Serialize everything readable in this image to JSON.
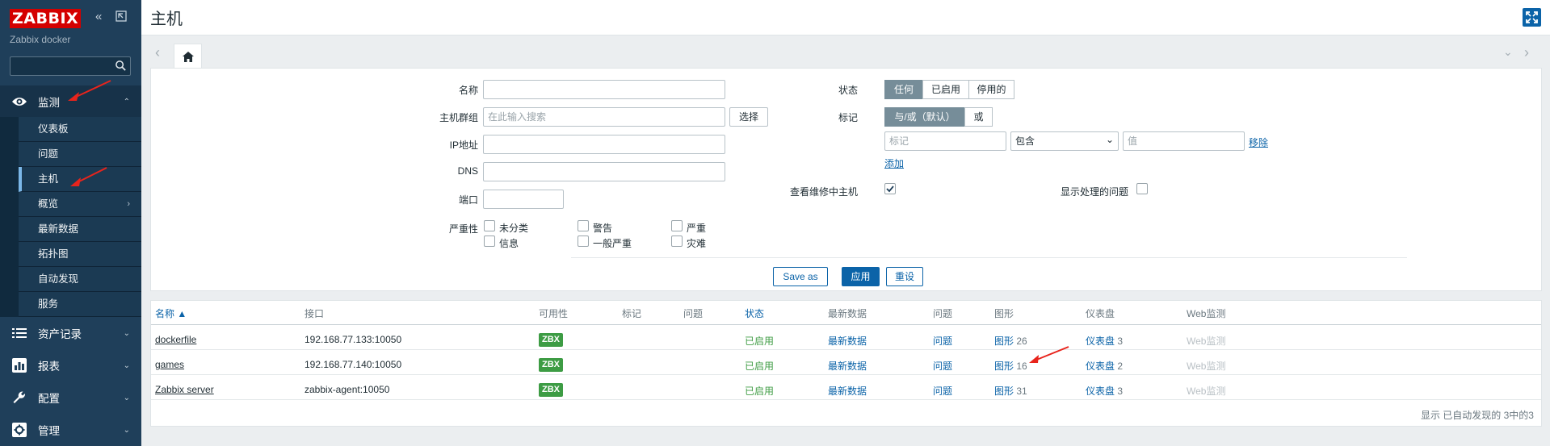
{
  "sidebar": {
    "logo": "ZABBIX",
    "instance": "Zabbix docker",
    "search_value": "",
    "menu": [
      {
        "label": "监测",
        "icon": "eye-icon"
      },
      {
        "label": "资产记录",
        "icon": "list-icon"
      },
      {
        "label": "报表",
        "icon": "bar-chart-icon"
      },
      {
        "label": "配置",
        "icon": "wrench-icon"
      },
      {
        "label": "管理",
        "icon": "gear-icon"
      }
    ],
    "submenu": [
      "仪表板",
      "问题",
      "主机",
      "概览",
      "最新数据",
      "拓扑图",
      "自动发现",
      "服务"
    ]
  },
  "header": {
    "title": "主机"
  },
  "filter": {
    "name_label": "名称",
    "hostgroup_label": "主机群组",
    "hostgroup_placeholder": "在此输入搜索",
    "select_button": "选择",
    "ip_label": "IP地址",
    "dns_label": "DNS",
    "port_label": "端口",
    "severity_label": "严重性",
    "severities": [
      "未分类",
      "警告",
      "严重",
      "信息",
      "一般严重",
      "灾难"
    ],
    "status_label": "状态",
    "status_options": [
      "任何",
      "已启用",
      "停用的"
    ],
    "tags_label": "标记",
    "tag_operator_options": [
      "与/或（默认）",
      "或"
    ],
    "tag_placeholder": "标记",
    "tag_condition": "包含",
    "tag_value_placeholder": "值",
    "remove_link": "移除",
    "add_link": "添加",
    "maintenance_label": "查看维修中主机",
    "maintenance_checked": true,
    "suppressed_label": "显示处理的问题",
    "suppressed_checked": false,
    "save_as": "Save as",
    "apply": "应用",
    "reset": "重设"
  },
  "table": {
    "headers": [
      "名称 ▲",
      "接口",
      "可用性",
      "标记",
      "问题",
      "状态",
      "最新数据",
      "问题",
      "图形",
      "仪表盘",
      "Web监测"
    ],
    "rows": [
      {
        "name": "dockerfile",
        "interface": "192.168.77.133:10050",
        "availability": "ZBX",
        "status": "已启用",
        "latest": "最新数据",
        "problems": "问题",
        "graphs_label": "图形",
        "graphs_count": "26",
        "dash_label": "仪表盘",
        "dash_count": "3",
        "web": "Web监测"
      },
      {
        "name": "games",
        "interface": "192.168.77.140:10050",
        "availability": "ZBX",
        "status": "已启用",
        "latest": "最新数据",
        "problems": "问题",
        "graphs_label": "图形",
        "graphs_count": "16",
        "dash_label": "仪表盘",
        "dash_count": "2",
        "web": "Web监测"
      },
      {
        "name": "Zabbix server",
        "interface": "zabbix-agent:10050",
        "availability": "ZBX",
        "status": "已启用",
        "latest": "最新数据",
        "problems": "问题",
        "graphs_label": "图形",
        "graphs_count": "31",
        "dash_label": "仪表盘",
        "dash_count": "3",
        "web": "Web监测"
      }
    ],
    "footer": "显示 已自动发现的 3中的3"
  },
  "colors": {
    "sidebar": "#1f3f5a",
    "accent": "#0b63a8",
    "logo": "#d40000",
    "ok": "#429e47",
    "annotation": "#e8241c"
  }
}
